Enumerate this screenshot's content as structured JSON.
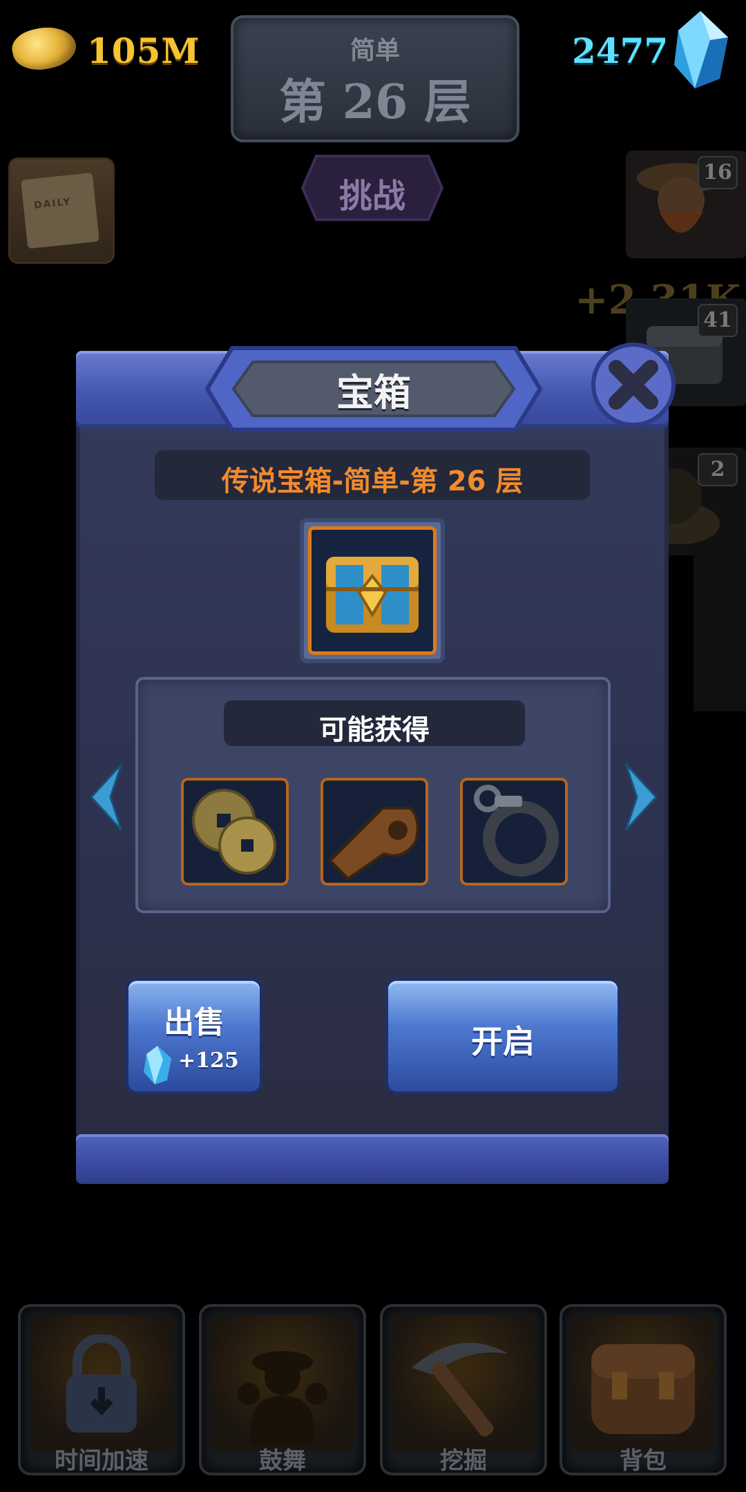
{
  "hud": {
    "gold_amount": "105M",
    "gem_amount": "2477",
    "floor_difficulty": "简单",
    "floor_number": "第 26 层",
    "challenge_label": "挑战",
    "daily_label": "DAILY"
  },
  "side_heroes": [
    {
      "level": "16",
      "icon": "bearded-miner-hero"
    },
    {
      "level": "41",
      "icon": "treasure-chest-hero"
    },
    {
      "level": "2",
      "icon": "rock-golem-hero"
    }
  ],
  "side_bonus": "+2.31K",
  "modal": {
    "title": "宝箱",
    "subtitle": "传说宝箱-简单-第 26 层",
    "chest_icon": "legendary-chest-icon",
    "rewards_title": "可能获得",
    "rewards": [
      {
        "icon": "ancient-coins-icon"
      },
      {
        "icon": "wooden-whistle-icon"
      },
      {
        "icon": "handcuffs-icon"
      }
    ],
    "sell_label": "出售",
    "sell_price": "+125",
    "open_label": "开启"
  },
  "bottom_nav": [
    {
      "label": "时间加速",
      "icon": "lock-time-icon"
    },
    {
      "label": "鼓舞",
      "icon": "cheering-miner-icon"
    },
    {
      "label": "挖掘",
      "icon": "pickaxe-icon"
    },
    {
      "label": "背包",
      "icon": "backpack-icon"
    }
  ],
  "colors": {
    "gold": "#f6c431",
    "gem": "#5ee1ff",
    "subtitle_orange": "#f38a2b",
    "modal_blue": "#4257ad",
    "button_blue": "#4c77cf"
  }
}
